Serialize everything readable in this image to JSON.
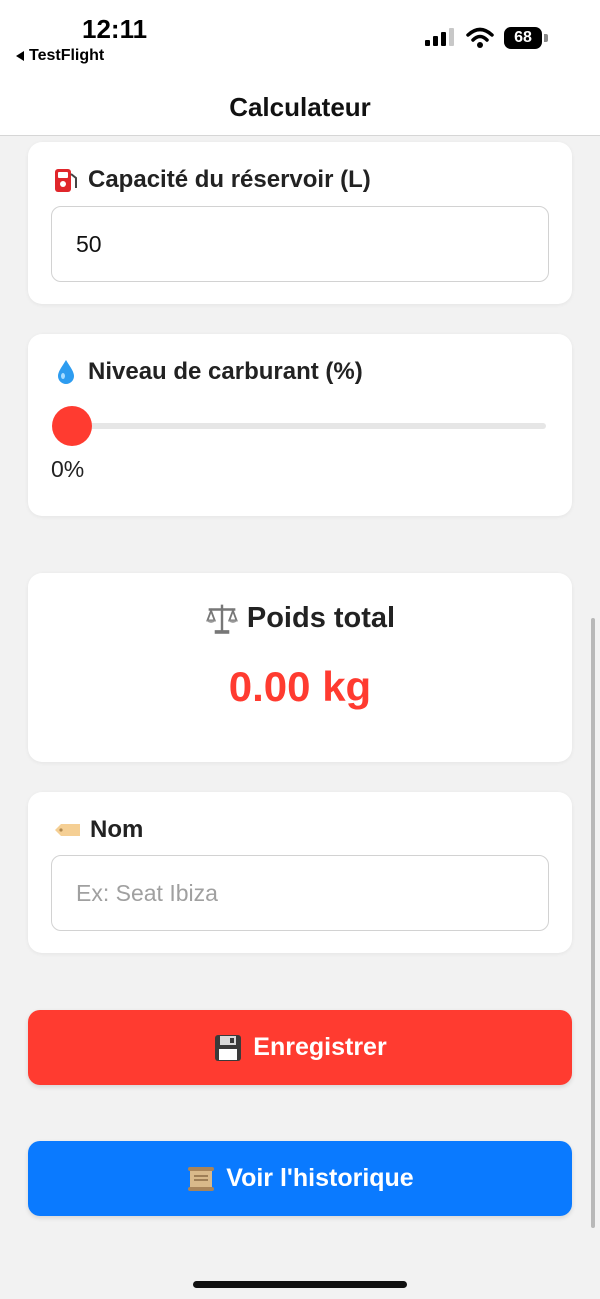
{
  "status_bar": {
    "time": "12:11",
    "back_app": "TestFlight",
    "battery": "68",
    "icons": [
      "signal-icon",
      "wifi-icon",
      "battery-icon"
    ]
  },
  "header": {
    "title": "Calculateur"
  },
  "tank": {
    "icon": "fuel-pump-icon",
    "label": "Capacité du réservoir (L)",
    "value": "50"
  },
  "fuel_level": {
    "icon": "droplet-icon",
    "label": "Niveau de carburant (%)",
    "slider_value": 0,
    "value_text": "0%"
  },
  "result": {
    "icon": "scales-icon",
    "title": "Poids total",
    "value": "0.00 kg"
  },
  "name_field": {
    "icon": "tag-icon",
    "label": "Nom",
    "placeholder": "Ex: Seat Ibiza",
    "value": ""
  },
  "buttons": {
    "save_icon": "floppy-disk-icon",
    "save_label": "Enregistrer",
    "history_icon": "scroll-icon",
    "history_label": "Voir l'historique"
  },
  "colors": {
    "accent_red": "#ff3b30",
    "accent_blue": "#0a7aff",
    "background": "#f2f2f2"
  }
}
